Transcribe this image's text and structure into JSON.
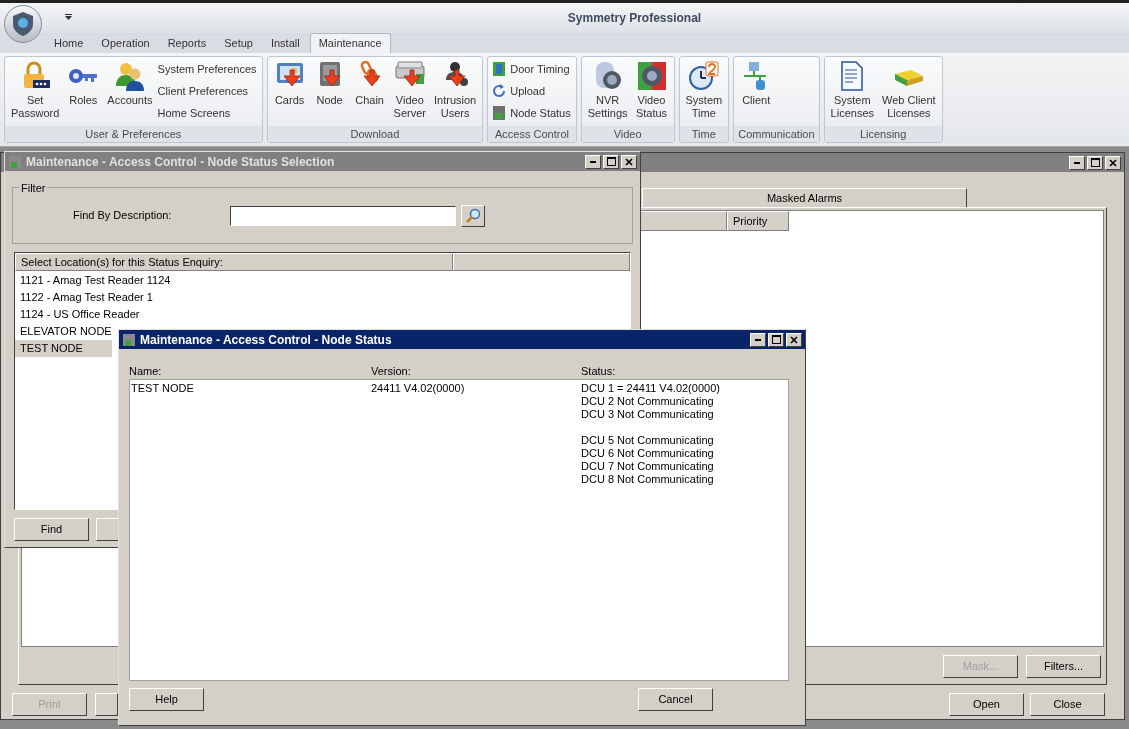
{
  "app": {
    "title": "Symmetry Professional"
  },
  "ribbon_tabs": [
    {
      "label": "Home",
      "selected": false
    },
    {
      "label": "Operation",
      "selected": false
    },
    {
      "label": "Reports",
      "selected": false
    },
    {
      "label": "Setup",
      "selected": false
    },
    {
      "label": "Install",
      "selected": false
    },
    {
      "label": "Maintenance",
      "selected": true
    }
  ],
  "ribbon_groups": [
    {
      "label": "User & Preferences",
      "items": [
        {
          "kind": "large",
          "label": "Set\nPassword"
        },
        {
          "kind": "large",
          "label": "Roles"
        },
        {
          "kind": "large",
          "label": "Accounts"
        },
        {
          "kind": "small",
          "label": "System Preferences"
        },
        {
          "kind": "small",
          "label": "Client Preferences"
        },
        {
          "kind": "small",
          "label": "Home Screens"
        }
      ]
    },
    {
      "label": "Download",
      "items": [
        {
          "kind": "large",
          "label": "Cards"
        },
        {
          "kind": "large",
          "label": "Node"
        },
        {
          "kind": "large",
          "label": "Chain"
        },
        {
          "kind": "large",
          "label": "Video\nServer"
        },
        {
          "kind": "large",
          "label": "Intrusion\nUsers"
        }
      ]
    },
    {
      "label": "Access Control",
      "items": [
        {
          "kind": "small",
          "label": "Door Timing"
        },
        {
          "kind": "small",
          "label": "Upload"
        },
        {
          "kind": "small",
          "label": "Node Status"
        }
      ]
    },
    {
      "label": "Video",
      "items": [
        {
          "kind": "large",
          "label": "NVR\nSettings"
        },
        {
          "kind": "large",
          "label": "Video\nStatus"
        }
      ]
    },
    {
      "label": "Time",
      "items": [
        {
          "kind": "large",
          "label": "System\nTime"
        }
      ]
    },
    {
      "label": "Communication",
      "items": [
        {
          "kind": "large",
          "label": "Client"
        }
      ]
    },
    {
      "label": "Licensing",
      "items": [
        {
          "kind": "large",
          "label": "System\nLicenses"
        },
        {
          "kind": "large",
          "label": "Web Client\nLicenses"
        }
      ]
    }
  ],
  "back_window": {
    "active": false,
    "tab": "Masked Alarms",
    "columns": [
      "Priority"
    ],
    "panel_buttons": [
      {
        "label": "Mask...",
        "disabled": true
      },
      {
        "label": "Filters...",
        "disabled": false
      }
    ],
    "footer_buttons": [
      {
        "label": "Print",
        "disabled": true
      },
      {
        "label": "Open",
        "disabled": false
      },
      {
        "label": "Close",
        "disabled": false
      }
    ]
  },
  "selection_window": {
    "active": false,
    "title": "Maintenance - Access Control - Node Status Selection",
    "filter_title": "Filter",
    "filter_label": "Find By Description:",
    "list_header": "Select Location(s) for this Status Enquiry:",
    "rows": [
      {
        "label": "1121 - Amag Test Reader 1124",
        "selected": false
      },
      {
        "label": "1122 - Amag Test Reader 1",
        "selected": false
      },
      {
        "label": "1124 - US Office Reader",
        "selected": false
      },
      {
        "label": "ELEVATOR NODE",
        "selected": false
      },
      {
        "label": "TEST NODE",
        "selected": true
      }
    ],
    "buttons": [
      "Find"
    ]
  },
  "status_window": {
    "active": true,
    "title": "Maintenance - Access Control - Node Status",
    "columns": [
      "Name:",
      "Version:",
      "Status:"
    ],
    "rows": [
      {
        "name": "TEST NODE",
        "version": "24411 V4.02(0000)",
        "status_blocks": [
          {
            "lines": [
              "DCU 1 = 24411 V4.02(0000)",
              "DCU 2 Not Communicating",
              "DCU 3 Not Communicating"
            ]
          },
          {
            "lines": [
              "DCU 5 Not Communicating",
              "DCU 6 Not Communicating",
              "DCU 7 Not Communicating",
              "DCU 8 Not Communicating"
            ]
          }
        ]
      }
    ],
    "buttons": [
      "Help",
      "Cancel"
    ]
  }
}
